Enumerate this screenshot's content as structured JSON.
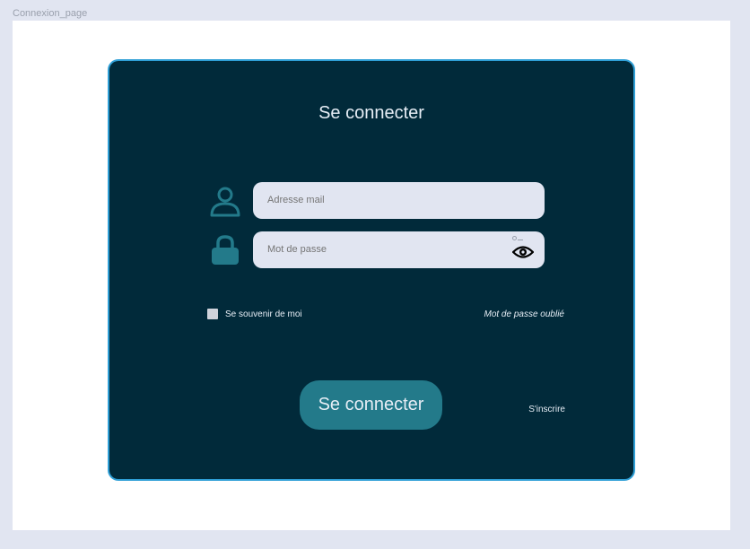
{
  "frame": {
    "label": "Connexion_page"
  },
  "login": {
    "title": "Se connecter",
    "email_placeholder": "Adresse mail",
    "password_placeholder": "Mot de passe",
    "remember_label": "Se souvenir de moi",
    "forgot_link": "Mot de passe oublié",
    "submit_label": "Se connecter",
    "signup_link": "S'inscrire"
  },
  "icons": {
    "email": "user-icon",
    "password": "lock-icon",
    "toggle_password": "eye-icon"
  },
  "colors": {
    "page_background": "#e1e5f1",
    "card_background": "#012a3a",
    "card_border": "#2f9fd6",
    "accent": "#237a8a",
    "input_background": "#e1e5f1"
  }
}
